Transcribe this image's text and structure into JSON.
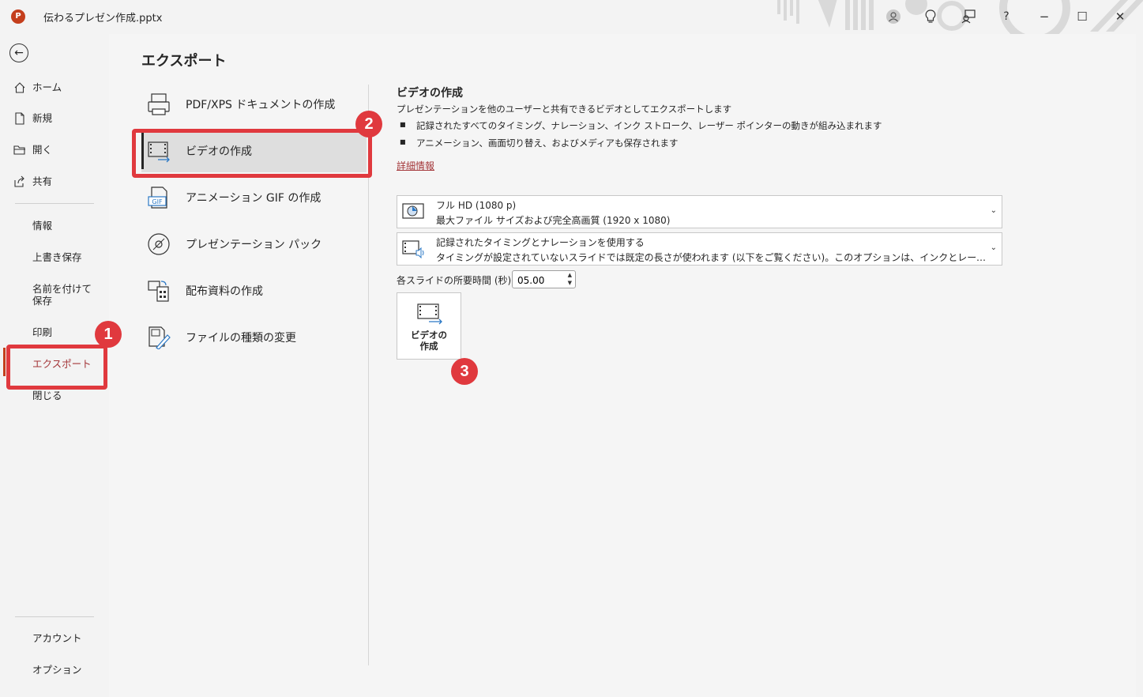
{
  "titlebar": {
    "app_icon": "P",
    "doc_title": "伝わるプレゼン作成.pptx",
    "buttons": [
      "account-icon",
      "lightbulb-icon",
      "feedback-icon",
      "help-icon",
      "minimize-icon",
      "maximize-icon",
      "close-icon"
    ],
    "help": "?",
    "minimize": "−",
    "maximize": "☐",
    "close": "✕"
  },
  "nav": {
    "back_icon": "←",
    "top_items": [
      {
        "label": "ホーム",
        "icon": "home-icon"
      },
      {
        "label": "新規",
        "icon": "new-doc-icon"
      },
      {
        "label": "開く",
        "icon": "folder-icon"
      },
      {
        "label": "共有",
        "icon": "share-icon"
      }
    ],
    "mid_items": [
      "情報",
      "上書き保存",
      "名前を付けて保存",
      "印刷",
      "エクスポート",
      "閉じる"
    ],
    "bottom_items": [
      "アカウント",
      "オプション"
    ],
    "active": "エクスポート"
  },
  "export": {
    "title": "エクスポート",
    "options": [
      {
        "label": "PDF/XPS ドキュメントの作成",
        "icon": "pdf-document-icon"
      },
      {
        "label": "ビデオの作成",
        "icon": "video-icon",
        "selected": true
      },
      {
        "label": "アニメーション GIF の作成",
        "icon": "gif-icon"
      },
      {
        "label": "プレゼンテーション パック",
        "icon": "cd-package-icon"
      },
      {
        "label": "配布資料の作成",
        "icon": "handout-icon"
      },
      {
        "label": "ファイルの種類の変更",
        "icon": "change-filetype-icon"
      }
    ]
  },
  "detail": {
    "title": "ビデオの作成",
    "description": "プレゼンテーションを他のユーザーと共有できるビデオとしてエクスポートします",
    "bullets": [
      "記録されたすべてのタイミング、ナレーション、インク ストローク、レーザー ポインターの動きが組み込まれます",
      "アニメーション、画面切り替え、およびメディアも保存されます"
    ],
    "more_link": "詳細情報",
    "quality": {
      "line1": "フル HD (1080 p)",
      "line2": "最大ファイル サイズおよび完全高画質 (1920 x 1080)"
    },
    "timing": {
      "line1": "記録されたタイミングとナレーションを使用する",
      "line2": "タイミングが設定されていないスライドでは既定の長さが使われます (以下をご覧ください)。このオプションは、インクとレーザー ポインターのジェスチャにも対応しています"
    },
    "duration_label": "各スライドの所要時間 (秒):",
    "duration_value": "05.00",
    "create_button": "ビデオの\n作成"
  },
  "annotations": {
    "badge1": "1",
    "badge2": "2",
    "badge3": "3",
    "color": "#e0393e"
  }
}
